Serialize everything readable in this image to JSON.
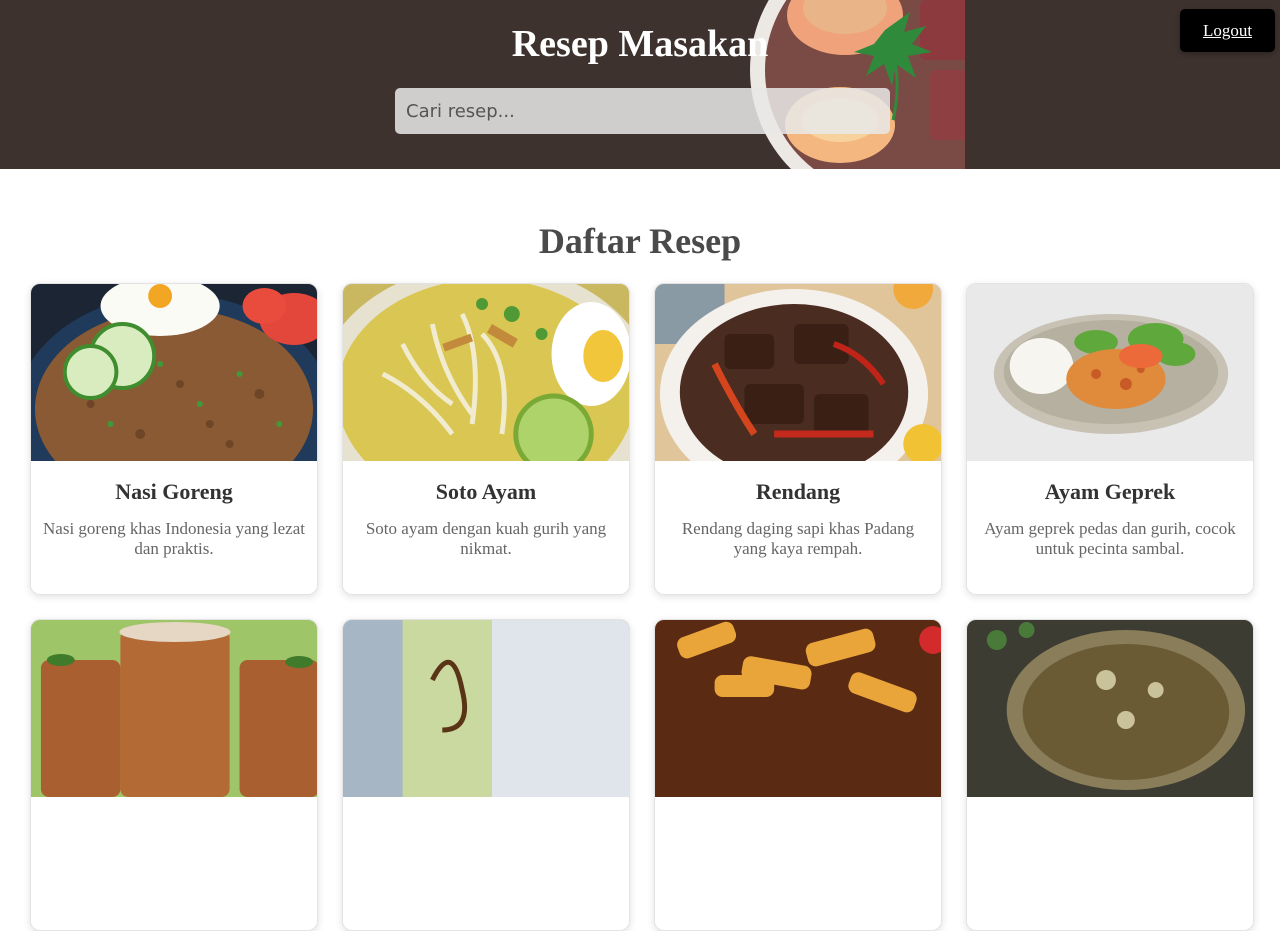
{
  "header": {
    "title": "Resep Masakan",
    "search_placeholder": "Cari resep...",
    "logout_label": "Logout"
  },
  "colors": {
    "header_bg": "#3e322e",
    "logout_bg": "#000000",
    "section_title": "#4a4a4a"
  },
  "section": {
    "title": "Daftar Resep"
  },
  "recipes": [
    {
      "title": "Nasi Goreng",
      "description": "Nasi goreng khas Indonesia yang lezat dan praktis.",
      "image": "nasi-goreng-photo"
    },
    {
      "title": "Soto Ayam",
      "description": "Soto ayam dengan kuah gurih yang nikmat.",
      "image": "soto-ayam-photo"
    },
    {
      "title": "Rendang",
      "description": "Rendang daging sapi khas Padang yang kaya rempah.",
      "image": "rendang-photo"
    },
    {
      "title": "Ayam Geprek",
      "description": "Ayam geprek pedas dan gurih, cocok untuk pecinta sambal.",
      "image": "ayam-geprek-photo"
    },
    {
      "title": "",
      "description": "",
      "image": "iced-tea-photo"
    },
    {
      "title": "",
      "description": "",
      "image": "drink-glass-photo"
    },
    {
      "title": "",
      "description": "",
      "image": "fries-photo"
    },
    {
      "title": "",
      "description": "",
      "image": "stew-bowl-photo"
    }
  ]
}
